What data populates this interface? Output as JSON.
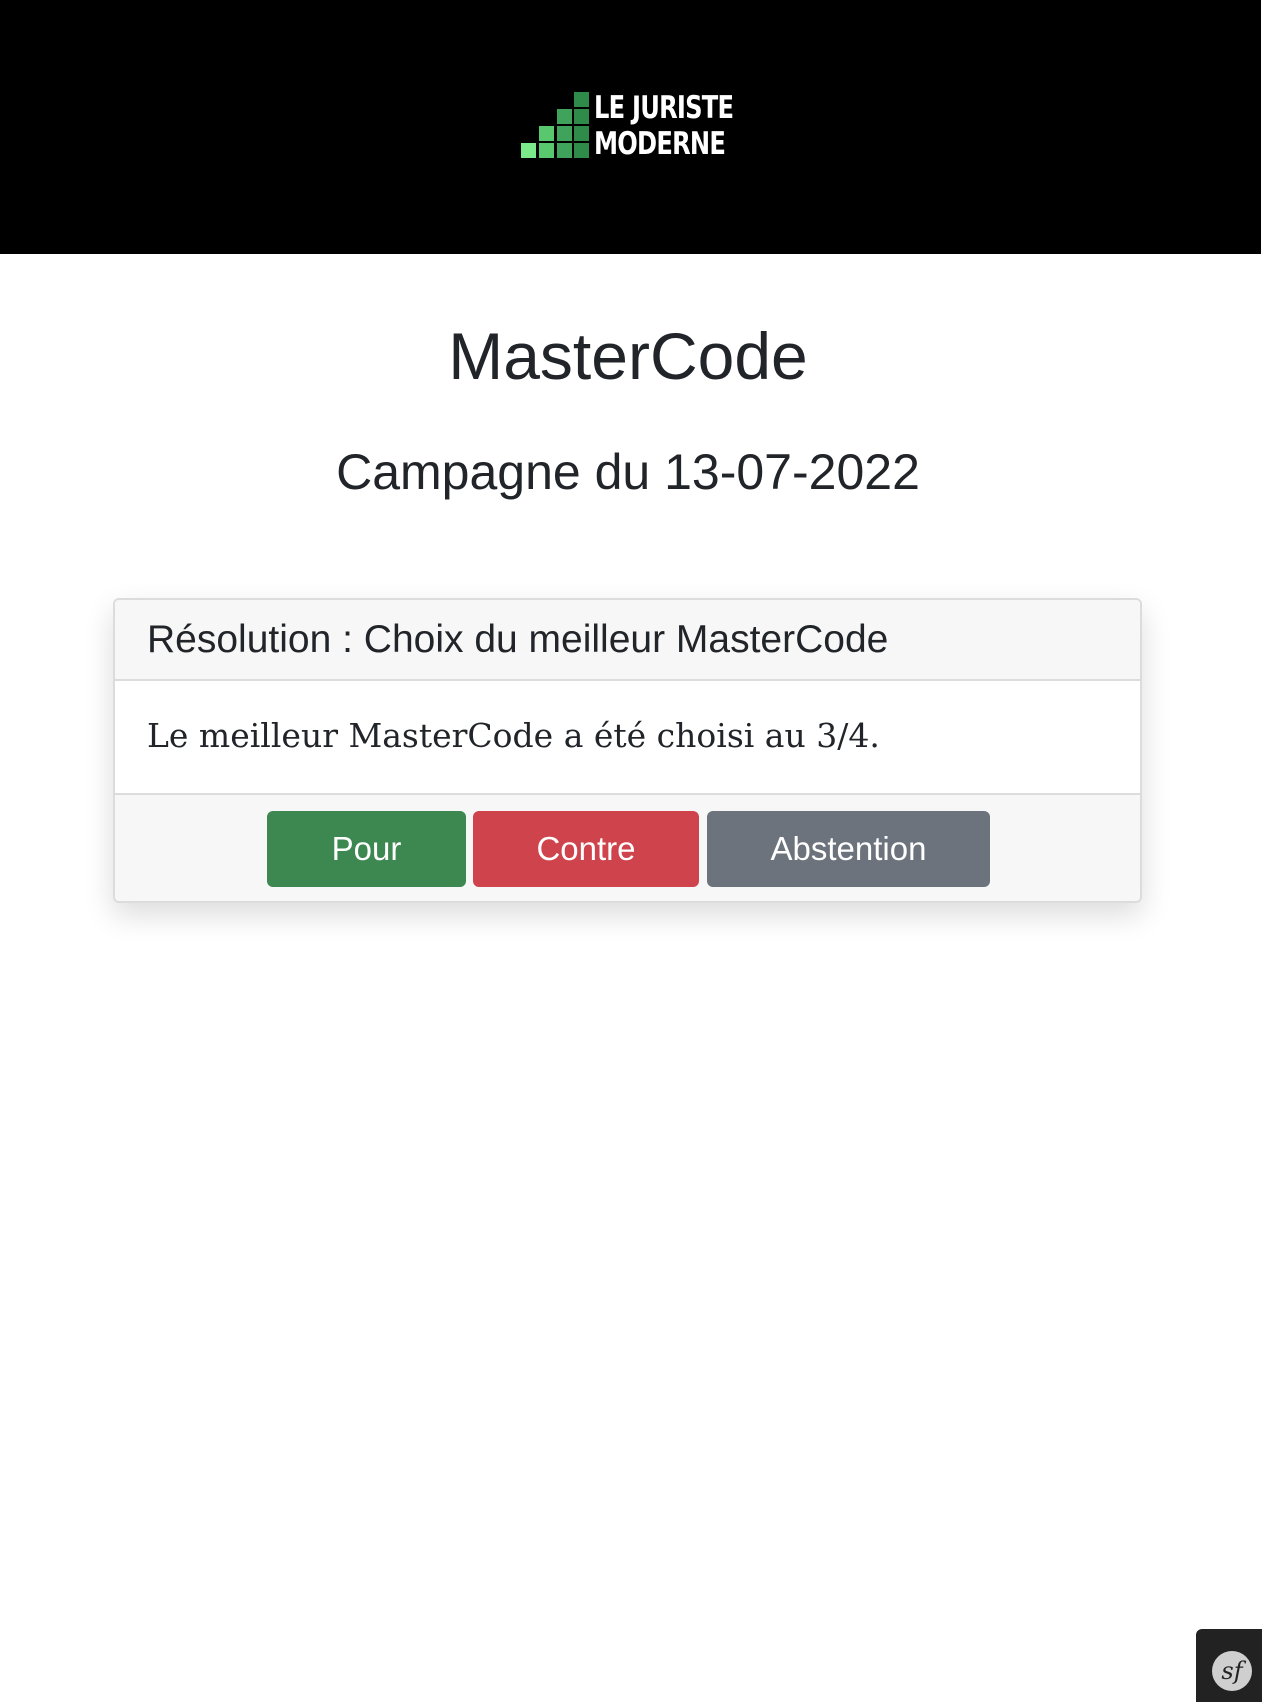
{
  "header": {
    "logo_line1": "LE JURISTE",
    "logo_line2": "MODERNE",
    "logo_icon": "green-staircase-blocks-icon",
    "background_color": "#000000",
    "logo_colors": [
      "#2e8b4a",
      "#3fa35b",
      "#58c76d",
      "#7be88a"
    ]
  },
  "page": {
    "title": "MasterCode",
    "subtitle": "Campagne du 13-07-2022"
  },
  "resolution": {
    "header": "Résolution : Choix du meilleur MasterCode",
    "body": "Le meilleur MasterCode a été choisi au 3/4."
  },
  "actions": {
    "pour_label": "Pour",
    "contre_label": "Contre",
    "abstention_label": "Abstention",
    "colors": {
      "pour": "#3d8750",
      "contre": "#cf444c",
      "abstention": "#6c737d"
    }
  },
  "debug_toolbar": {
    "icon": "symfony-icon",
    "glyph": "sf"
  }
}
